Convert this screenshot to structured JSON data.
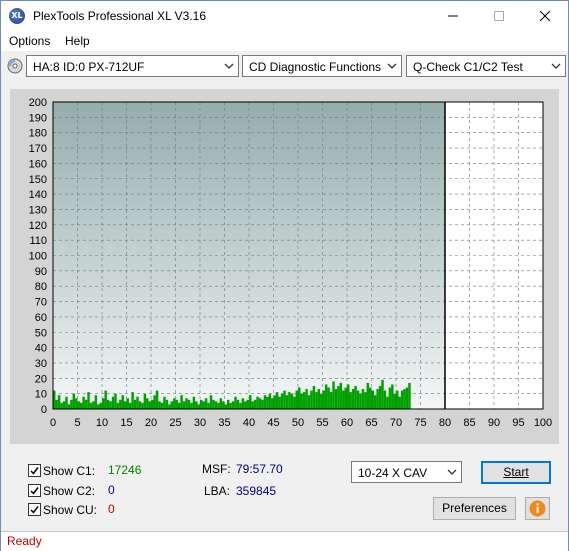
{
  "window": {
    "title": "PlexTools Professional XL V3.16",
    "app_icon_text": "XL"
  },
  "menu": {
    "items": [
      "Options",
      "Help"
    ]
  },
  "toolbar": {
    "drive": "HA:8 ID:0  PX-712UF",
    "function": "CD Diagnostic Functions",
    "test": "Q-Check C1/C2 Test",
    "icons": [
      "cd-drive-icon",
      "chevron-down-icon"
    ]
  },
  "chart_data": {
    "type": "bar",
    "title": "",
    "xlabel": "",
    "ylabel": "",
    "xlim": [
      0,
      100
    ],
    "ylim": [
      0,
      200
    ],
    "x_ticks": [
      0,
      5,
      10,
      15,
      20,
      25,
      30,
      35,
      40,
      45,
      50,
      55,
      60,
      65,
      70,
      75,
      80,
      85,
      90,
      95,
      100
    ],
    "y_ticks": [
      0,
      10,
      20,
      30,
      40,
      50,
      60,
      70,
      80,
      90,
      100,
      110,
      120,
      130,
      140,
      150,
      160,
      170,
      180,
      190,
      200
    ],
    "grid": true,
    "test_end_minute": 80,
    "series": [
      {
        "name": "C1",
        "color": "#00a000",
        "x_step": 0.5,
        "values": [
          12,
          6,
          9,
          4,
          5,
          8,
          3,
          6,
          10,
          7,
          5,
          4,
          8,
          6,
          11,
          4,
          5,
          9,
          3,
          4,
          7,
          12,
          6,
          5,
          8,
          10,
          4,
          6,
          9,
          5,
          7,
          4,
          11,
          6,
          8,
          5,
          4,
          10,
          7,
          5,
          6,
          9,
          12,
          5,
          4,
          8,
          6,
          3,
          5,
          7,
          6,
          4,
          9,
          5,
          7,
          6,
          4,
          8,
          5,
          3,
          6,
          5,
          7,
          4,
          9,
          6,
          5,
          4,
          7,
          5,
          3,
          6,
          4,
          5,
          8,
          6,
          4,
          7,
          5,
          6,
          9,
          5,
          6,
          8,
          7,
          6,
          9,
          8,
          10,
          7,
          9,
          11,
          8,
          10,
          12,
          9,
          11,
          10,
          8,
          12,
          14,
          10,
          11,
          13,
          9,
          12,
          15,
          11,
          13,
          10,
          12,
          16,
          14,
          11,
          18,
          13,
          15,
          17,
          12,
          14,
          16,
          11,
          13,
          15,
          12,
          10,
          13,
          11,
          17,
          14,
          12,
          9,
          13,
          15,
          19,
          12,
          8,
          14,
          16,
          10,
          12,
          8,
          12,
          13,
          14,
          17
        ]
      },
      {
        "name": "C2",
        "color": "#0000c0",
        "x_step": 0.5,
        "values": []
      }
    ]
  },
  "stats": {
    "show_c1": {
      "label": "Show C1:",
      "value": "17246",
      "color": "#008000"
    },
    "show_c2": {
      "label": "Show C2:",
      "value": "0",
      "color": "#0000c0"
    },
    "show_cu": {
      "label": "Show CU:",
      "value": "0",
      "color": "#c00000"
    },
    "msf_label": "MSF:",
    "msf_value": "79:57.70",
    "lba_label": "LBA:",
    "lba_value": "359845",
    "value_color": "#000080"
  },
  "controls": {
    "speed": "10-24 X CAV",
    "start_label": "Start",
    "preferences_label": "Preferences"
  },
  "status": {
    "text": "Ready",
    "color": "#c00000"
  }
}
